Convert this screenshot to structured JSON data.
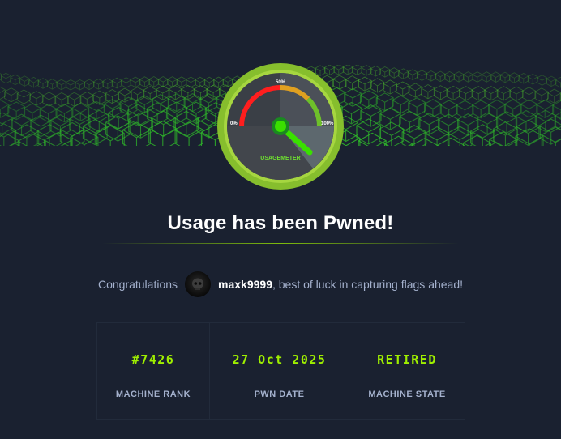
{
  "colors": {
    "background": "#1a2130",
    "accent": "#9fef00",
    "text_muted": "#a4b1cd",
    "text_primary": "#ffffff"
  },
  "badge": {
    "gauge_labels": {
      "min": "0%",
      "mid": "50%",
      "max": "100%"
    },
    "caption": "USAGEMETER"
  },
  "title": "Usage has been Pwned!",
  "congrats": {
    "prefix": "Congratulations",
    "username": "maxk9999",
    "suffix": ", best of luck in capturing flags ahead!"
  },
  "stats": [
    {
      "value": "#7426",
      "label": "MACHINE RANK"
    },
    {
      "value": "27 Oct 2025",
      "label": "PWN DATE"
    },
    {
      "value": "RETIRED",
      "label": "MACHINE STATE"
    }
  ]
}
